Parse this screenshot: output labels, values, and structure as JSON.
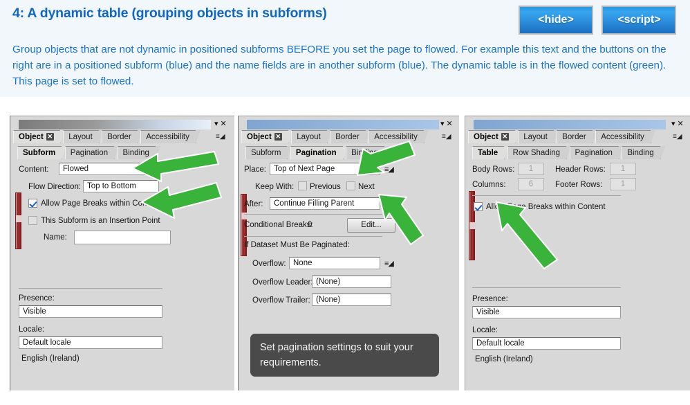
{
  "header": {
    "title": "4: A dynamic table (grouping objects in subforms)",
    "buttons": [
      {
        "label": "<hide>",
        "name": "hide-button"
      },
      {
        "label": "<script>",
        "name": "script-button"
      }
    ],
    "intro": "Group objects that are not dynamic in positioned subforms BEFORE you set the page to flowed. For example this text and the buttons on the right are in a positioned subform (blue) and the name fields are in another subform (blue). The dynamic table is in the flowed content (green). This page is set to flowed."
  },
  "colors": {
    "title_blue": "#1267c4",
    "body_blue": "#1b72cc",
    "button_blue": "#2d8fdd",
    "arrow_green": "#3ab33a",
    "panel_gray": "#d8d8d8",
    "marker_red": "#8d2222",
    "callout_dark": "#4a4a4a"
  },
  "panel1": {
    "titlebar": {
      "collapse_glyph": "▾",
      "close_glyph": "✕"
    },
    "tabs_primary": [
      {
        "label": "Object",
        "active": true,
        "closable": true
      },
      {
        "label": "Layout",
        "active": false
      },
      {
        "label": "Border",
        "active": false
      },
      {
        "label": "Accessibility",
        "active": false
      }
    ],
    "tabs_secondary": [
      {
        "label": "Subform",
        "active": true
      },
      {
        "label": "Pagination",
        "active": false
      },
      {
        "label": "Binding",
        "active": false
      }
    ],
    "content_label": "Content:",
    "content_value": "Flowed",
    "flow_direction_label": "Flow Direction:",
    "flow_direction_value": "Top to Bottom",
    "allow_breaks_label": "Allow Page Breaks within Content",
    "allow_breaks_checked": true,
    "insertion_point_label": "This Subform is an Insertion Point",
    "insertion_point_checked": false,
    "name_label": "Name:",
    "name_value": "",
    "presence_label": "Presence:",
    "presence_value": "Visible",
    "locale_label": "Locale:",
    "locale_value": "Default locale",
    "locale_sub": "English (Ireland)"
  },
  "panel2": {
    "titlebar": {
      "collapse_glyph": "▾",
      "close_glyph": "✕"
    },
    "tabs_primary": [
      {
        "label": "Object",
        "active": true,
        "closable": true
      },
      {
        "label": "Layout",
        "active": false
      },
      {
        "label": "Border",
        "active": false
      },
      {
        "label": "Accessibility",
        "active": false
      }
    ],
    "tabs_secondary": [
      {
        "label": "Subform",
        "active": false
      },
      {
        "label": "Pagination",
        "active": true
      },
      {
        "label": "Binding",
        "active": false
      }
    ],
    "place_label": "Place:",
    "place_value": "Top of Next Page",
    "keep_with_label": "Keep With:",
    "keep_previous_label": "Previous",
    "keep_previous_checked": false,
    "keep_next_label": "Next",
    "keep_next_checked": false,
    "after_label": "After:",
    "after_value": "Continue Filling Parent",
    "conditional_breaks_label": "Conditional Breaks:",
    "conditional_breaks_value": "0",
    "edit_button_label": "Edit...",
    "dataset_heading": "If Dataset Must Be Paginated:",
    "overflow_label": "Overflow:",
    "overflow_value": "None",
    "overflow_leader_label": "Overflow Leader:",
    "overflow_leader_value": "(None)",
    "overflow_trailer_label": "Overflow Trailer:",
    "overflow_trailer_value": "(None)",
    "callout_text": "Set pagination settings to suit your requirements."
  },
  "panel3": {
    "titlebar": {
      "collapse_glyph": "▾",
      "close_glyph": "✕"
    },
    "tabs_primary": [
      {
        "label": "Object",
        "active": true,
        "closable": true
      },
      {
        "label": "Layout",
        "active": false
      },
      {
        "label": "Border",
        "active": false
      },
      {
        "label": "Accessibility",
        "active": false
      }
    ],
    "tabs_secondary": [
      {
        "label": "Table",
        "active": true
      },
      {
        "label": "Row Shading",
        "active": false
      },
      {
        "label": "Pagination",
        "active": false
      },
      {
        "label": "Binding",
        "active": false
      }
    ],
    "body_rows_label": "Body Rows:",
    "body_rows_value": "1",
    "header_rows_label": "Header Rows:",
    "header_rows_value": "1",
    "columns_label": "Columns:",
    "columns_value": "6",
    "footer_rows_label": "Footer Rows:",
    "footer_rows_value": "1",
    "allow_breaks_label": "Allow Page Breaks within Content",
    "allow_breaks_checked": true,
    "presence_label": "Presence:",
    "presence_value": "Visible",
    "locale_label": "Locale:",
    "locale_value": "Default locale",
    "locale_sub": "English (Ireland)"
  },
  "annotations": {
    "arrows": [
      {
        "name": "arrow-content-dropdown",
        "target": "panel1 Content dropdown"
      },
      {
        "name": "arrow-allow-page-breaks",
        "target": "panel1 Allow Page Breaks checkbox"
      },
      {
        "name": "arrow-place-field",
        "target": "panel2 Place field"
      },
      {
        "name": "arrow-after-field",
        "target": "panel2 After field"
      },
      {
        "name": "arrow-table-allow-breaks",
        "target": "panel3 Allow Page Breaks checkbox"
      }
    ]
  }
}
